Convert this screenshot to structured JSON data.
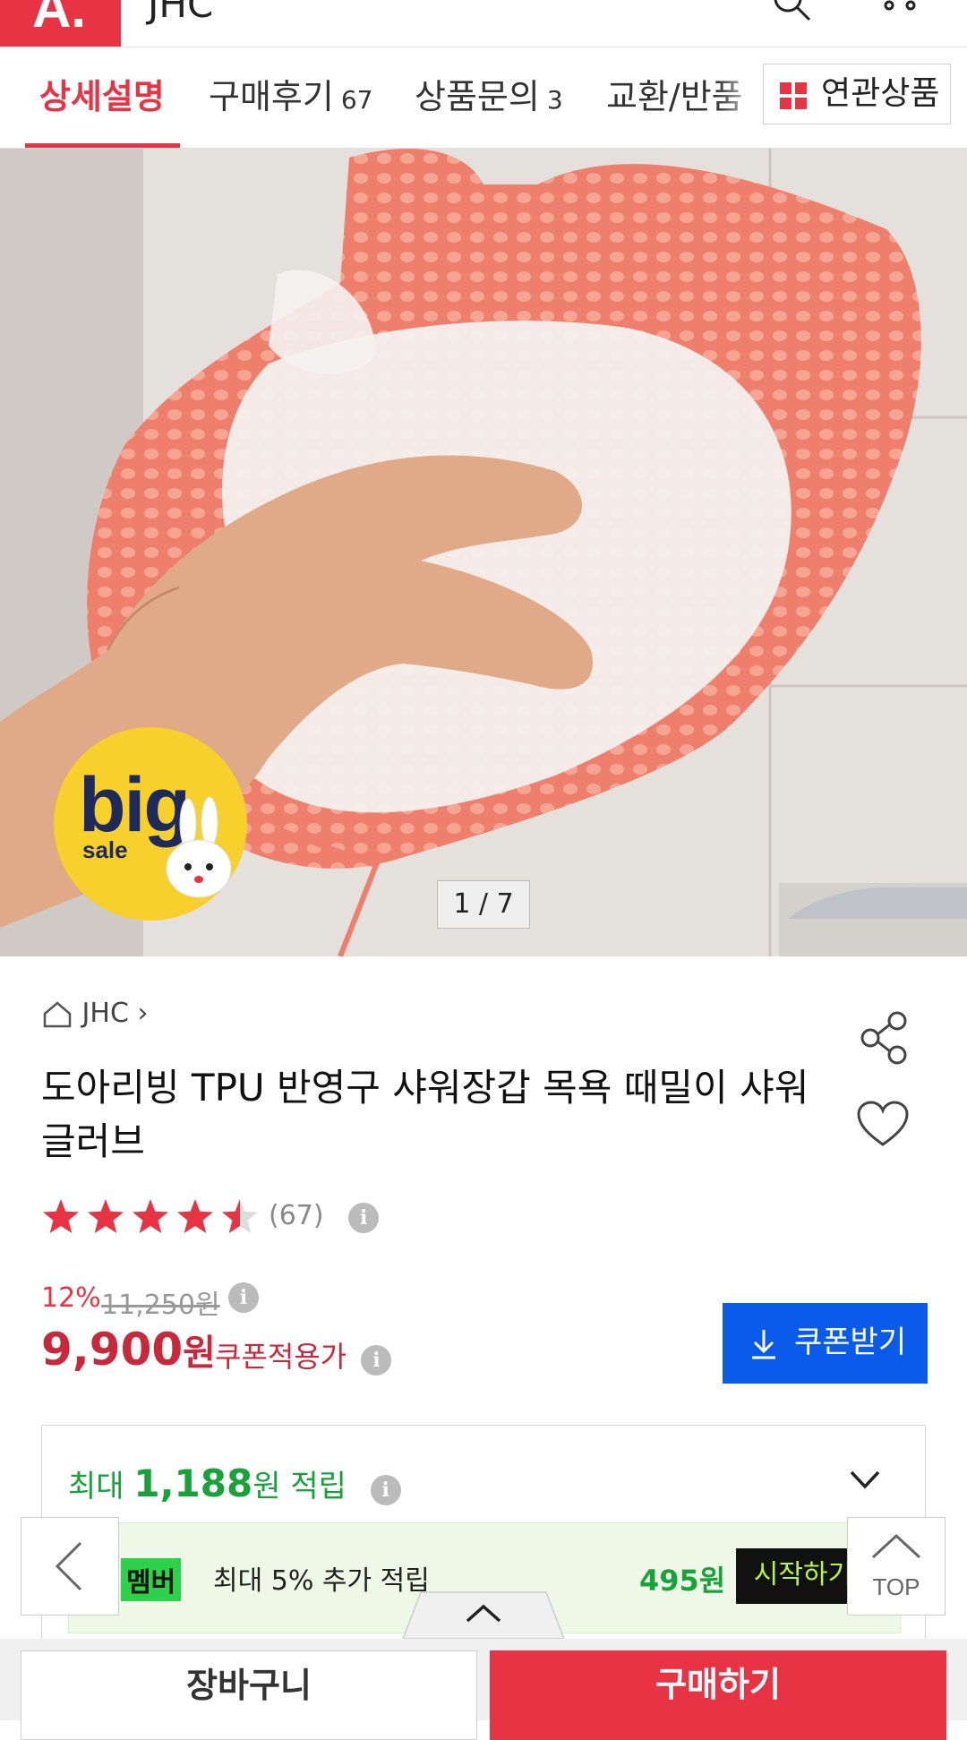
{
  "header": {
    "logo_text": "A.",
    "title": "JHC"
  },
  "tabs": [
    {
      "label": "상세설명",
      "count": ""
    },
    {
      "label": "구매후기",
      "count": "67"
    },
    {
      "label": "상품문의",
      "count": "3"
    },
    {
      "label": "교환/반품",
      "count": ""
    }
  ],
  "related_button": "연관상품",
  "hero": {
    "badge_big": "big",
    "badge_sale": "sale",
    "image_counter": "1 / 7"
  },
  "product": {
    "brand": "JHC",
    "title": "도아리빙 TPU 반영구 샤워장갑 목욕 때밀이 샤워글러브",
    "rating": 4.5,
    "rating_max": 5,
    "review_count": "(67)",
    "discount": "12%",
    "original_price": "11,250원",
    "price": "9,900",
    "price_unit": "원",
    "coupon_price_label": "쿠폰적용가",
    "coupon_button": "쿠폰받기"
  },
  "points": {
    "prefix": "최대",
    "amount": "1,188",
    "unit": "원",
    "suffix": "적립",
    "member_tag": "멤버",
    "member_text": "최대 5% 추가 적립",
    "member_amount": "495원",
    "start_button": "시작하기"
  },
  "floating": {
    "top_label": "TOP"
  },
  "bottom": {
    "cart_button": "장바구니",
    "buy_button": "구매하기"
  },
  "colors": {
    "accent": "#e83344",
    "coupon_blue": "#0b5bea",
    "points_green": "#17a33a"
  }
}
